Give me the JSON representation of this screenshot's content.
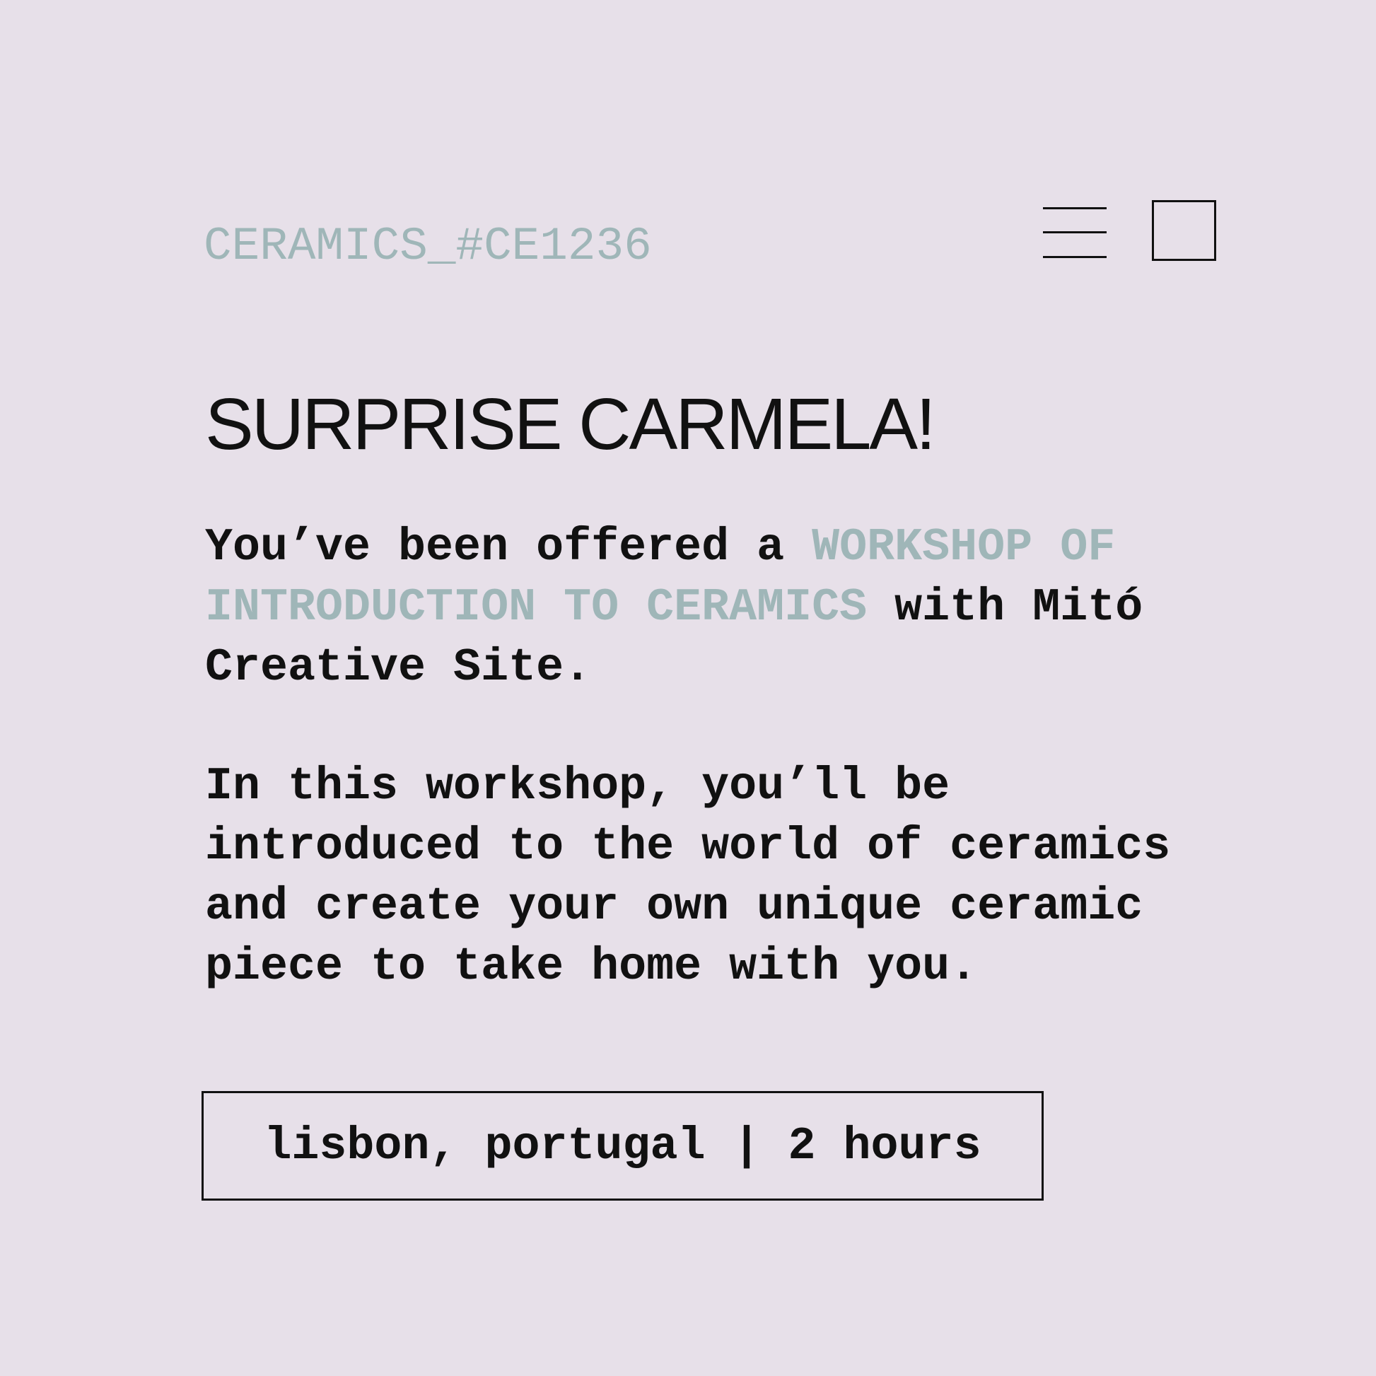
{
  "header": {
    "code": "CERAMICS_#CE1236",
    "menu_icon": "hamburger-menu-icon",
    "checkbox_icon": "square-outline-icon"
  },
  "title": "SURPRISE CARMELA!",
  "intro": {
    "line1_before": "You’ve been offered a ",
    "line1_highlight": "WORKSHOP OF",
    "line2_highlight": "INTRODUCTION TO CERAMICS",
    "line2_after": " with Mitó",
    "line3": "Creative Site."
  },
  "description": {
    "lines": [
      "In this workshop, you’ll be",
      "introduced to the world of ceramics",
      "and create your own unique ceramic",
      "piece to take home with you."
    ]
  },
  "info": {
    "text": "lisbon, portugal | 2 hours"
  },
  "colors": {
    "background": "#e7e0e9",
    "accent": "#9fb6b8",
    "text": "#111111"
  }
}
